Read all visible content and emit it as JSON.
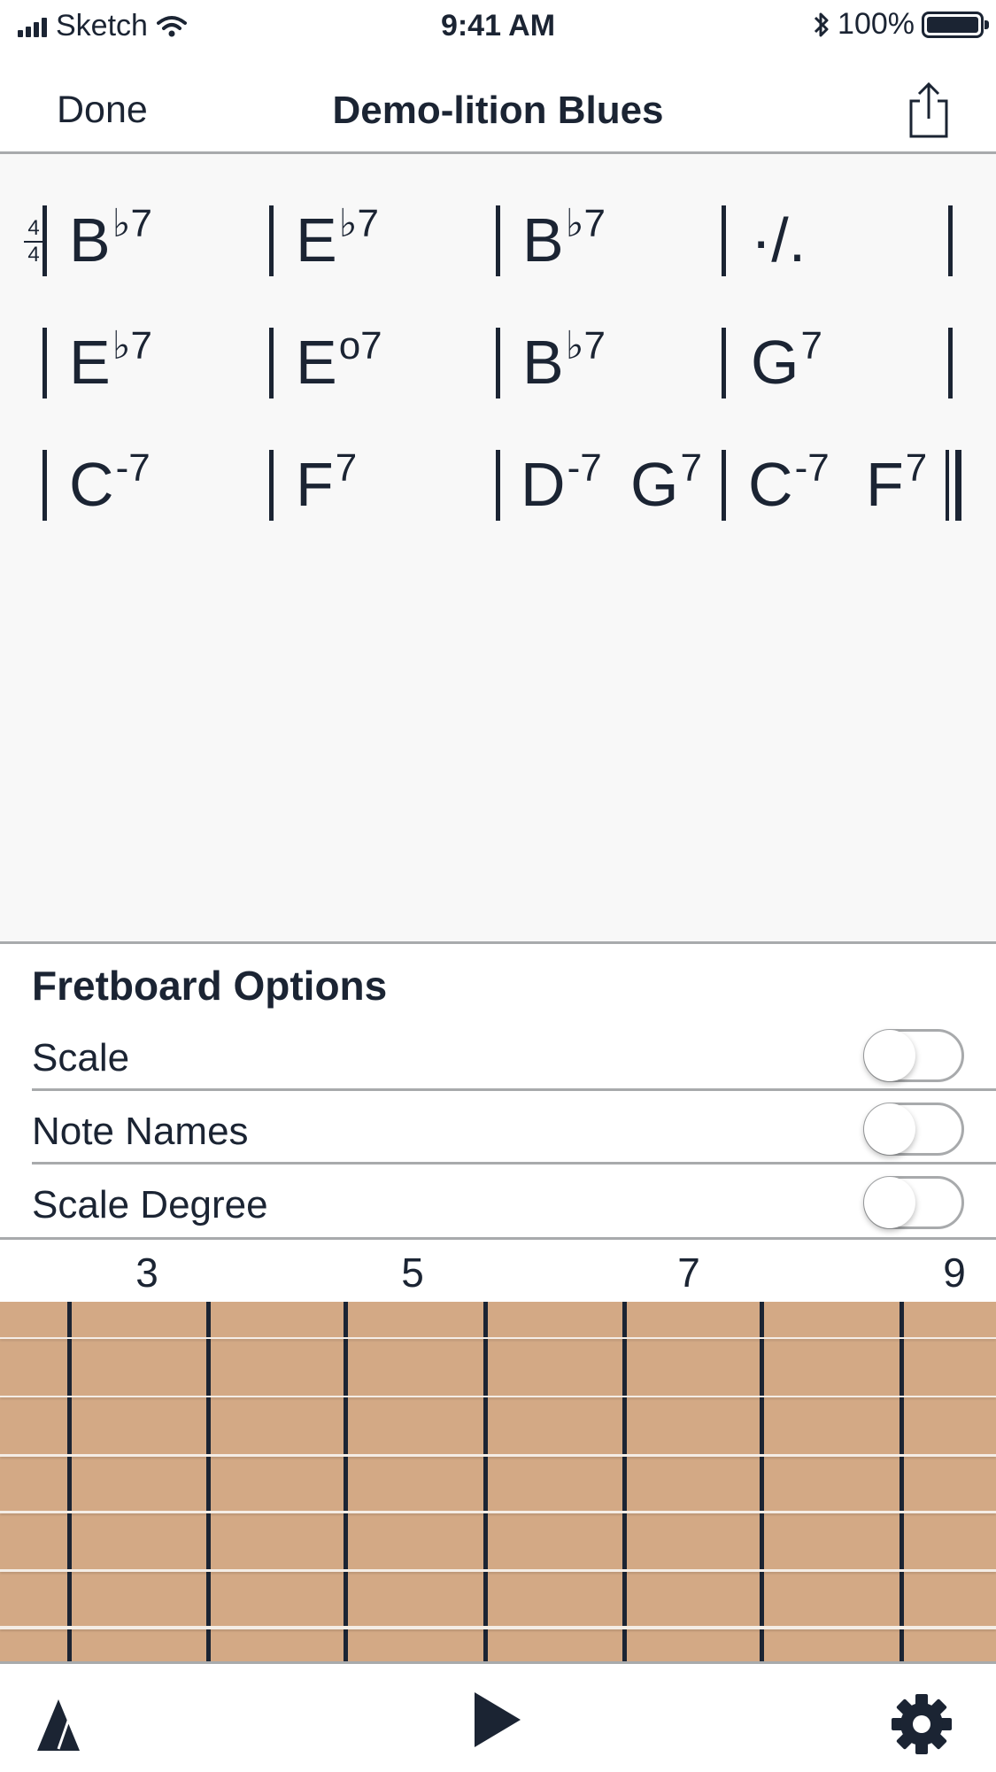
{
  "status_bar": {
    "carrier": "Sketch",
    "time": "9:41 AM",
    "battery": "100%"
  },
  "nav": {
    "done_label": "Done",
    "title": "Demo-lition Blues",
    "share_icon": "share-icon"
  },
  "chart": {
    "time_signature": {
      "top": "4",
      "bottom": "4"
    },
    "rows": [
      [
        {
          "chords": [
            {
              "root": "B",
              "ext": "♭7"
            }
          ]
        },
        {
          "chords": [
            {
              "root": "E",
              "ext": "♭7"
            }
          ]
        },
        {
          "chords": [
            {
              "root": "B",
              "ext": "♭7"
            }
          ]
        },
        {
          "chords": [
            {
              "root": "·/.",
              "ext": ""
            }
          ]
        }
      ],
      [
        {
          "chords": [
            {
              "root": "E",
              "ext": "♭7"
            }
          ]
        },
        {
          "chords": [
            {
              "root": "E",
              "ext": "o7"
            }
          ]
        },
        {
          "chords": [
            {
              "root": "B",
              "ext": "♭7"
            }
          ]
        },
        {
          "chords": [
            {
              "root": "G",
              "ext": "7"
            }
          ]
        }
      ],
      [
        {
          "chords": [
            {
              "root": "C",
              "ext": "-7"
            }
          ]
        },
        {
          "chords": [
            {
              "root": "F",
              "ext": "7"
            }
          ]
        },
        {
          "chords": [
            {
              "root": "D",
              "ext": "-7"
            },
            {
              "root": "G",
              "ext": "7"
            }
          ]
        },
        {
          "chords": [
            {
              "root": "C",
              "ext": "-7"
            },
            {
              "root": "F",
              "ext": "7"
            }
          ]
        }
      ]
    ]
  },
  "fretboard_options": {
    "title": "Fretboard Options",
    "items": [
      {
        "label": "Scale",
        "enabled": false
      },
      {
        "label": "Note Names",
        "enabled": false
      },
      {
        "label": "Scale Degree",
        "enabled": false
      }
    ]
  },
  "fret_numbers": [
    "3",
    "5",
    "7",
    "9"
  ],
  "colors": {
    "ink": "#1b2433",
    "chart_background": "#f8f8f8",
    "fretboard_wood": "#d3a985",
    "string": "#f4ede6",
    "divider": "#a8aaac"
  },
  "toolbar": {
    "metronome_icon": "metronome-icon",
    "play_icon": "play-icon",
    "settings_icon": "gear-icon"
  }
}
